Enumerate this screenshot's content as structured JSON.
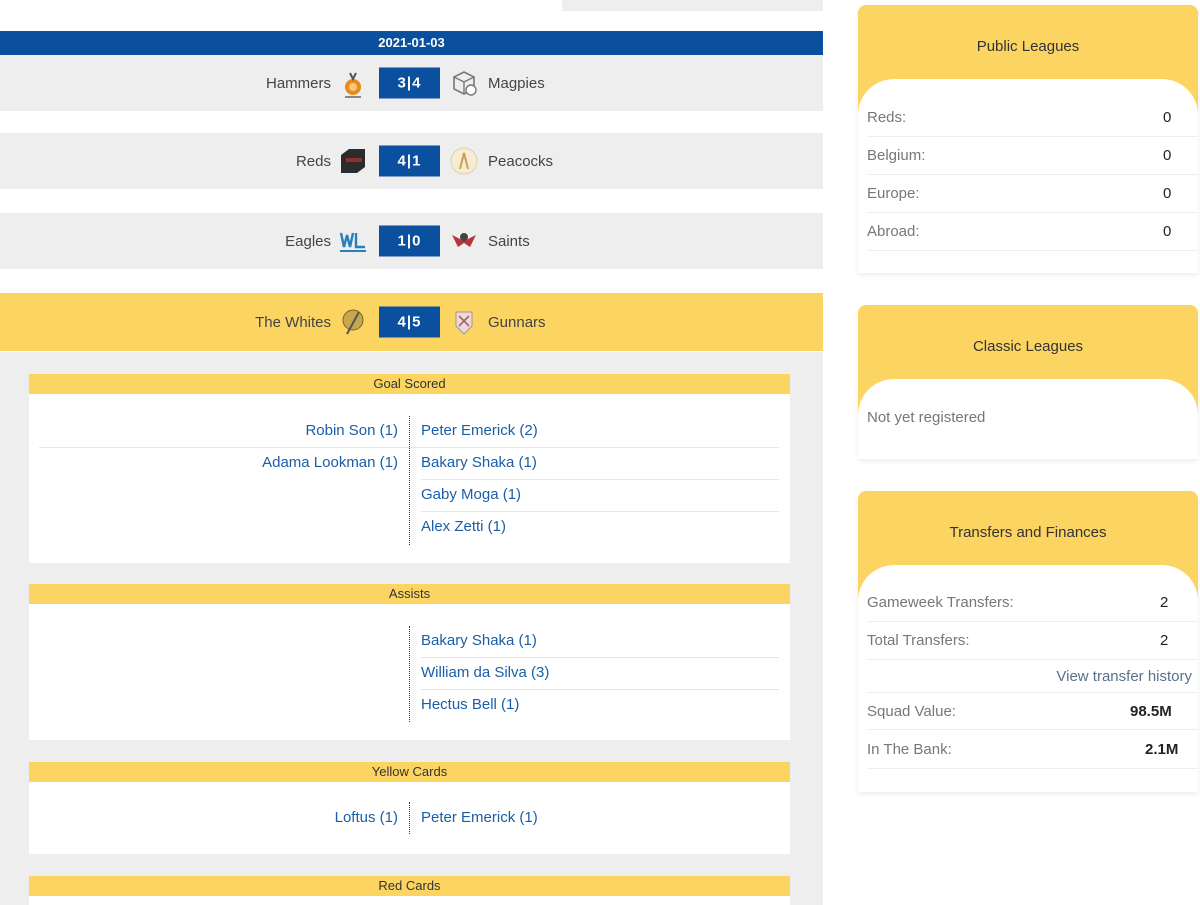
{
  "date": "2021-01-03",
  "matches": [
    {
      "home": "Hammers",
      "score": "3|4",
      "away": "Magpies"
    },
    {
      "home": "Reds",
      "score": "4|1",
      "away": "Peacocks"
    },
    {
      "home": "Eagles",
      "score": "1|0",
      "away": "Saints"
    },
    {
      "home": "The Whites",
      "score": "4|5",
      "away": "Gunnars"
    }
  ],
  "stats": {
    "goals": {
      "title": "Goal Scored",
      "home": [
        "Robin Son (1)",
        "Adama Lookman (1)"
      ],
      "away": [
        "Peter Emerick (2)",
        "Bakary Shaka (1)",
        "Gaby Moga (1)",
        "Alex Zetti (1)"
      ]
    },
    "assists": {
      "title": "Assists",
      "home": [],
      "away": [
        "Bakary Shaka (1)",
        "William da Silva (3)",
        "Hectus Bell (1)"
      ]
    },
    "yellow": {
      "title": "Yellow Cards",
      "home": [
        "Loftus (1)"
      ],
      "away": [
        "Peter Emerick (1)"
      ]
    },
    "red": {
      "title": "Red Cards"
    }
  },
  "public_leagues": {
    "title": "Public Leagues",
    "rows": [
      {
        "label": "Reds:",
        "value": "0"
      },
      {
        "label": "Belgium:",
        "value": "0"
      },
      {
        "label": "Europe:",
        "value": "0"
      },
      {
        "label": "Abroad:",
        "value": "0"
      }
    ]
  },
  "classic_leagues": {
    "title": "Classic Leagues",
    "message": "Not yet registered"
  },
  "transfers": {
    "title": "Transfers and Finances",
    "gameweek_label": "Gameweek Transfers:",
    "gameweek_value": "2",
    "total_label": "Total Transfers:",
    "total_value": "2",
    "history_link": "View transfer history",
    "squad_label": "Squad Value:",
    "squad_value": "98.5M",
    "bank_label": "In The Bank:",
    "bank_value": "2.1M"
  },
  "colors": {
    "navy": "#0b4f9f",
    "gold": "#fcd462",
    "link": "#1a5ea8"
  }
}
